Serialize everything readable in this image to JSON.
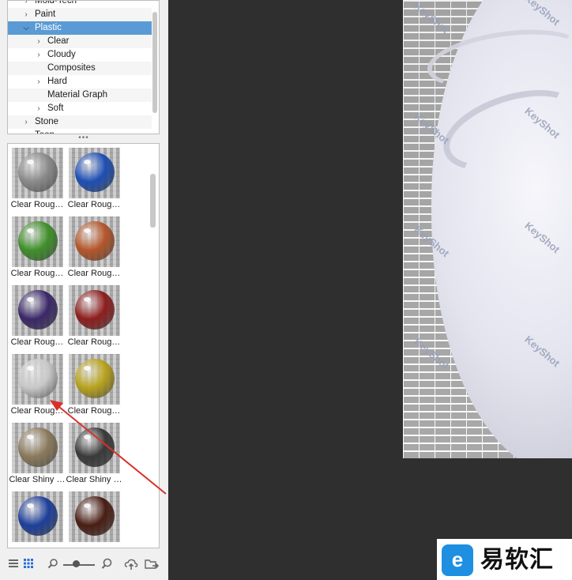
{
  "tree": {
    "items": [
      {
        "label": "Mold-Tech",
        "level": 0,
        "expandable": true
      },
      {
        "label": "Paint",
        "level": 0,
        "expandable": true
      },
      {
        "label": "Plastic",
        "level": 0,
        "expandable": true,
        "expanded": true,
        "selected": true
      },
      {
        "label": "Clear",
        "level": 1,
        "expandable": true
      },
      {
        "label": "Cloudy",
        "level": 1,
        "expandable": true
      },
      {
        "label": "Composites",
        "level": 1,
        "expandable": false
      },
      {
        "label": "Hard",
        "level": 1,
        "expandable": true
      },
      {
        "label": "Material Graph",
        "level": 1,
        "expandable": false
      },
      {
        "label": "Soft",
        "level": 1,
        "expandable": true
      },
      {
        "label": "Stone",
        "level": 0,
        "expandable": true
      },
      {
        "label": "Toon",
        "level": 0,
        "expandable": true
      }
    ]
  },
  "thumbnails": [
    {
      "label": "Clear Roug…",
      "color": "#8a8a8a"
    },
    {
      "label": "Clear Roug…",
      "color": "#1e4fb4"
    },
    {
      "label": "Clear Roug…",
      "color": "#3f8f2a"
    },
    {
      "label": "Clear Roug…",
      "color": "#b4562a"
    },
    {
      "label": "Clear Roug…",
      "color": "#3a2868"
    },
    {
      "label": "Clear Roug…",
      "color": "#8e1e1e"
    },
    {
      "label": "Clear Roug…",
      "color": "#c8c8c8"
    },
    {
      "label": "Clear Roug…",
      "color": "#b8a21e"
    },
    {
      "label": "Clear Shiny …",
      "color": "#8a7a5c"
    },
    {
      "label": "Clear Shiny …",
      "color": "#3a3a3a"
    },
    {
      "label": "",
      "color": "#1e3f9a"
    },
    {
      "label": "",
      "color": "#4a1e14"
    }
  ],
  "toolbar": {
    "list_view_icon": "list-icon",
    "grid_view_icon": "grid-icon",
    "zoom_out_icon": "zoom-out-icon",
    "zoom_in_icon": "zoom-in-icon",
    "upload_icon": "cloud-upload-icon",
    "folder_icon": "folder-export-icon"
  },
  "viewport": {
    "watermark_text": "KeyShot",
    "background": "#2f2f2f"
  },
  "badge": {
    "logo_letter": "e",
    "brand_name": "易软汇",
    "logo_color": "#1e8fe1"
  },
  "colors": {
    "selection": "#5b9bd5",
    "annotation_arrow": "#d9302a"
  }
}
